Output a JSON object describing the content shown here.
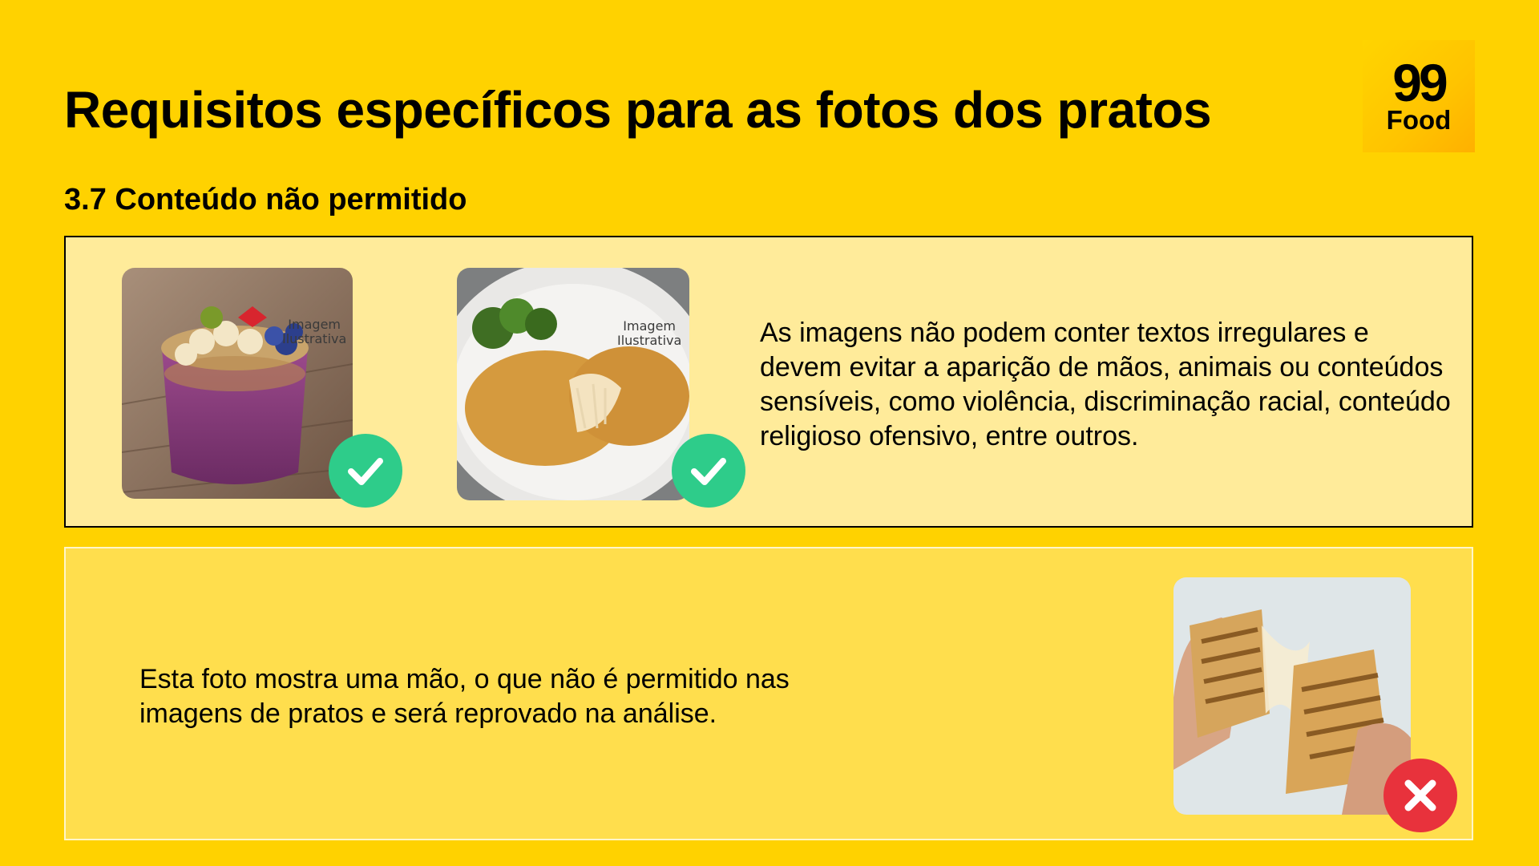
{
  "header": {
    "title": "Requisitos específicos para as fotos dos pratos",
    "section": "3.7 Conteúdo não permitido"
  },
  "logo": {
    "number": "99",
    "word": "Food"
  },
  "allowed_panel": {
    "text": "As imagens não podem conter textos irregulares e devem evitar a aparição de mãos, animais ou conteúdos sensíveis, como violência, discriminação racial, conteúdo religioso ofensivo, entre outros.",
    "photos": [
      {
        "watermark_line1": "Imagem",
        "watermark_line2": "Ilustrativa",
        "status_icon": "check-icon"
      },
      {
        "watermark_line1": "Imagem",
        "watermark_line2": "Ilustrativa",
        "status_icon": "check-icon"
      }
    ]
  },
  "rejected_panel": {
    "text": "Esta foto mostra uma mão, o que não é permitido nas imagens de pratos e será reprovado na análise.",
    "status_icon": "x-icon"
  },
  "colors": {
    "background": "#FFD200",
    "allowed_panel": "#FFEB9A",
    "rejected_panel": "#FFDE4D",
    "approved": "#2ECC8A",
    "rejected": "#E8323C"
  }
}
